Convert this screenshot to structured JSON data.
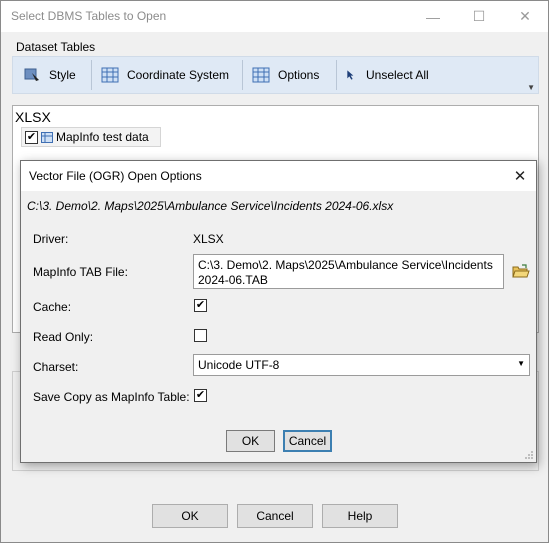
{
  "window": {
    "title": "Select DBMS Tables to Open",
    "minimize_icon": "minimize-icon",
    "maximize_icon": "maximize-icon",
    "close_icon": "close-icon"
  },
  "dataset_tables": {
    "label": "Dataset Tables",
    "toolbar": [
      {
        "label": "Style",
        "icon": "style-icon"
      },
      {
        "label": "Coordinate System",
        "icon": "grid-icon"
      },
      {
        "label": "Options",
        "icon": "grid-icon"
      },
      {
        "label": "Unselect All",
        "icon": "cursor-icon"
      }
    ],
    "overflow_icon": "chevron-down-icon"
  },
  "list": {
    "group": "XLSX",
    "items": [
      {
        "label": "MapInfo test data",
        "checked": true
      }
    ]
  },
  "buttons": {
    "ok": "OK",
    "cancel": "Cancel",
    "help": "Help"
  },
  "dialog": {
    "title": "Vector File (OGR) Open Options",
    "path": "C:\\3. Demo\\2. Maps\\2025\\Ambulance Service\\Incidents 2024-06.xlsx",
    "driver_label": "Driver:",
    "driver_value": "XLSX",
    "tab_label": "MapInfo TAB File:",
    "tab_value": "C:\\3. Demo\\2. Maps\\2025\\Ambulance Service\\Incidents 2024-06.TAB",
    "cache_label": "Cache:",
    "cache_checked": true,
    "readonly_label": "Read Only:",
    "readonly_checked": false,
    "charset_label": "Charset:",
    "charset_value": "Unicode UTF-8",
    "savecopy_label": "Save Copy as MapInfo Table:",
    "savecopy_checked": true,
    "ok": "OK",
    "cancel": "Cancel"
  }
}
